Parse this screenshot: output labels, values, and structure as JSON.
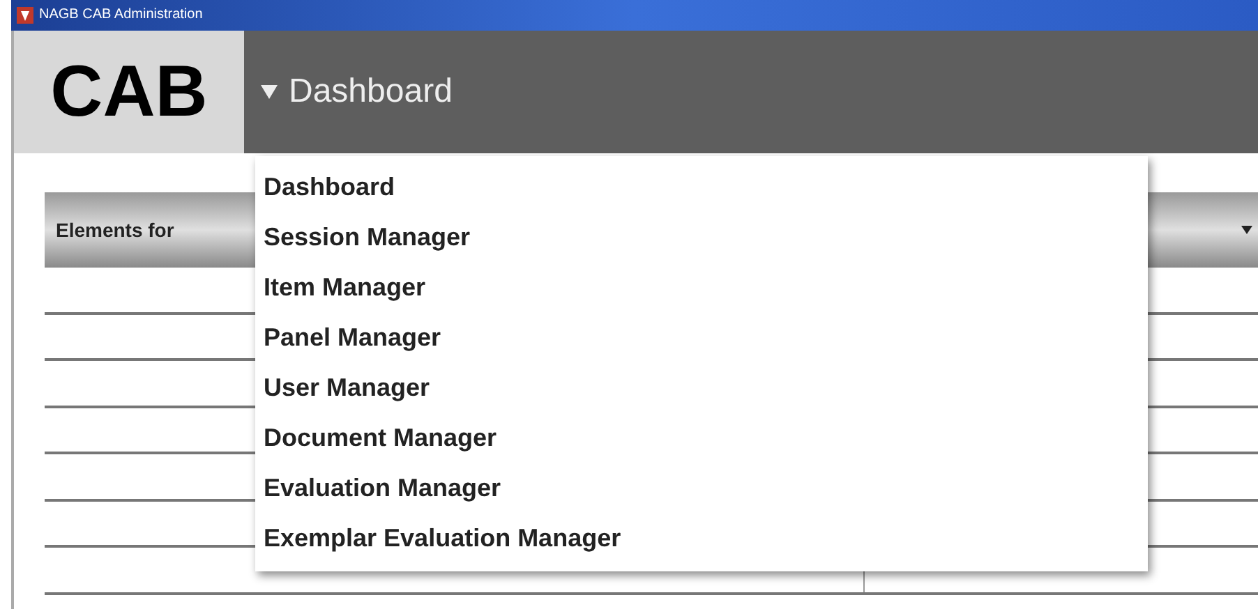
{
  "window": {
    "title": "NAGB CAB Administration"
  },
  "header": {
    "logo": "CAB",
    "nav_dropdown": {
      "label": "Dashboard",
      "expanded": true
    }
  },
  "menu": {
    "items": [
      {
        "label": "Dashboard"
      },
      {
        "label": "Session Manager"
      },
      {
        "label": "Item Manager"
      },
      {
        "label": "Panel Manager"
      },
      {
        "label": "User Manager"
      },
      {
        "label": "Document Manager"
      },
      {
        "label": "Evaluation Manager"
      },
      {
        "label": "Exemplar Evaluation Manager"
      }
    ]
  },
  "table": {
    "columns": [
      "Elements for"
    ]
  }
}
